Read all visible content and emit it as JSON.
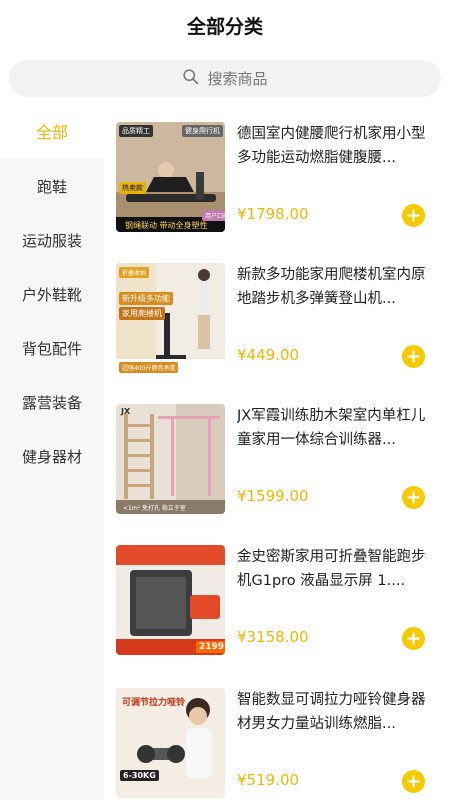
{
  "header": {
    "title": "全部分类"
  },
  "search": {
    "placeholder": "搜索商品"
  },
  "sidebar": {
    "items": [
      {
        "label": "全部",
        "active": true
      },
      {
        "label": "跑鞋"
      },
      {
        "label": "运动服装"
      },
      {
        "label": "户外鞋靴"
      },
      {
        "label": "背包配件"
      },
      {
        "label": "露营装备"
      },
      {
        "label": "健身器材"
      }
    ]
  },
  "products": [
    {
      "name": "德国室内健腰爬行机家用小型多功能运动燃脂健腹腰...",
      "price": "¥1798.00",
      "image_tags": [
        "品质精工",
        "健身爬行机",
        "热卖款",
        "钢绳联动  带动全身塑性",
        "用户口碑"
      ]
    },
    {
      "name": "新款多功能家用爬楼机室内原地踏步机多弹簧登山机...",
      "price": "¥449.00",
      "image_tags": [
        "折叠收纳",
        "新升级多功能",
        "家用爬楼机",
        "超强400斤静音承重"
      ]
    },
    {
      "name": "JX军霞训练肋木架室内单杠儿童家用一体综合训练器...",
      "price": "¥1599.00",
      "image_tags": [
        "JX",
        "<1m² 免打孔 稳立于室"
      ]
    },
    {
      "name": "金史密斯家用可折叠智能跑步机G1pro 液晶显示屏 1....",
      "price": "¥3158.00",
      "image_tags": [
        "2199"
      ]
    },
    {
      "name": "智能数显可调拉力哑铃健身器材男女力量站训练燃脂...",
      "price": "¥519.00",
      "image_tags": [
        "可调节拉力哑铃",
        "6-30KG"
      ]
    }
  ],
  "colors": {
    "accent": "#f2b705",
    "button": "#f6c900",
    "sidebar_bg": "#f7f7f7",
    "search_bg": "#f2f2f2"
  }
}
